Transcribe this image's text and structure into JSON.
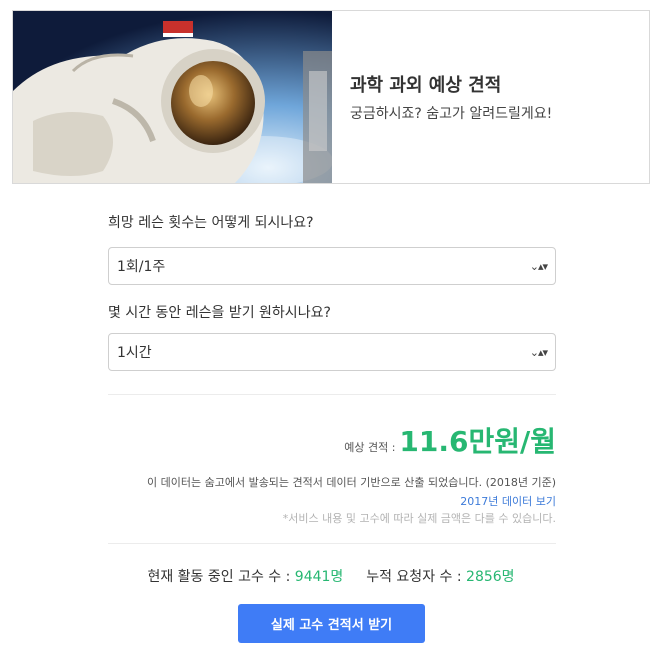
{
  "banner": {
    "image_alt": "astronaut",
    "title": "과학 과외 예상 견적",
    "subtitle": "궁금하시죠? 숨고가 알려드릴게요!"
  },
  "form": {
    "frequency_question": "희망 레슨 횟수는 어떻게 되시나요?",
    "frequency_value": "1회/1주",
    "duration_question": "몇 시간 동안 레슨을 받기 원하시나요?",
    "duration_value": "1시간"
  },
  "estimate": {
    "label": "예상 견적 :",
    "value": "11.6만원/월",
    "note": "이 데이터는 숨고에서 발송되는 견적서 데이터 기반으로 산출 되었습니다. (2018년 기준)",
    "link_2017": "2017년 데이터 보기",
    "disclaimer": "*서비스 내용 및 고수에 따라 실제 금액은 다를 수 있습니다."
  },
  "stats": {
    "active_label": "현재 활동 중인 고수 수 :",
    "active_value": "9441명",
    "requesters_label": "누적 요청자 수 :",
    "requesters_value": "2856명"
  },
  "cta": {
    "label": "실제 고수 견적서 받기"
  },
  "colors": {
    "accent_green": "#27b772",
    "primary_blue": "#3f7cf6",
    "link_blue": "#3d7bd9"
  },
  "icons": {
    "select_caret": "chevron-up-down-icon"
  }
}
